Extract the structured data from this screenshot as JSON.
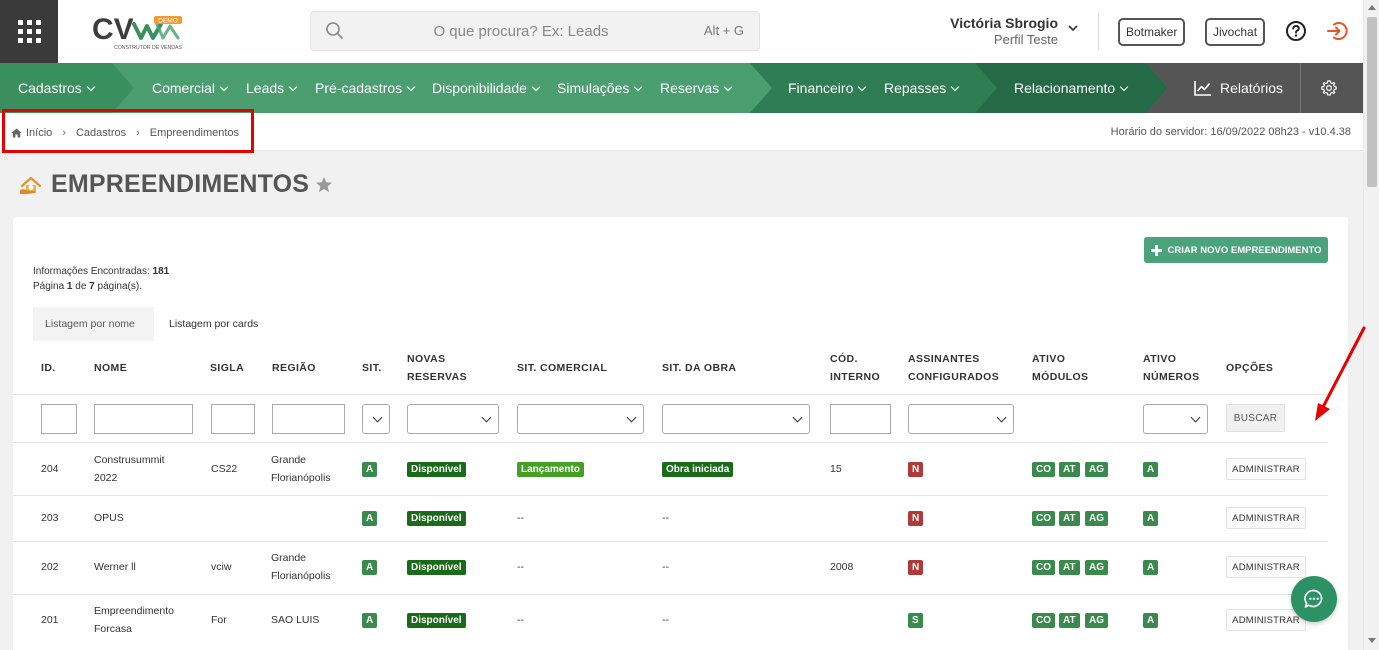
{
  "header": {
    "logo_text": "CV",
    "logo_badge": "DEMO",
    "logo_tagline": "CONSTRUTOR DE VENDAS",
    "search_placeholder": "O que procura? Ex: Leads",
    "search_shortcut": "Alt + G",
    "user_name": "Victória Sbrogio",
    "user_role": "Perfil Teste",
    "botmaker_label": "Botmaker",
    "jivochat_label": "Jivochat"
  },
  "nav": {
    "items": [
      {
        "label": "Cadastros"
      },
      {
        "label": "Comercial"
      },
      {
        "label": "Leads"
      },
      {
        "label": "Pré-cadastros"
      },
      {
        "label": "Disponibilidade"
      },
      {
        "label": "Simulações"
      },
      {
        "label": "Reservas"
      },
      {
        "label": "Financeiro"
      },
      {
        "label": "Repasses"
      },
      {
        "label": "Relacionamento"
      }
    ],
    "reports_label": "Relatórios",
    "colors": {
      "base": "#3a8f5f",
      "light": "#4ea877",
      "mid": "#2f7d53",
      "dark": "#256a46",
      "grey": "#555555"
    }
  },
  "breadcrumb": {
    "items": [
      "Início",
      "Cadastros",
      "Empreendimentos"
    ],
    "server_time": "Horário do servidor: 16/09/2022 08h23 - v10.4.38"
  },
  "page": {
    "title": "EMPREENDIMENTOS",
    "create_button": "CRIAR NOVO EMPREENDIMENTO",
    "info_found_label": "Informações Encontradas:",
    "info_found_count": "181",
    "page_word": "Página",
    "page_current": "1",
    "page_of": "de",
    "page_total": "7",
    "page_suffix": "página(s).",
    "tabs": [
      {
        "label": "Listagem por nome",
        "active": true
      },
      {
        "label": "Listagem por cards",
        "active": false
      }
    ]
  },
  "table": {
    "headers": {
      "id": "ID.",
      "nome": "NOME",
      "sigla": "SIGLA",
      "regiao": "REGIÃO",
      "sit": "SIT.",
      "novas_reservas": "NOVAS RESERVAS",
      "sit_comercial": "SIT. COMERCIAL",
      "sit_obra": "SIT. DA OBRA",
      "cod_interno": "CÓD. INTERNO",
      "assinantes": "ASSINANTES CONFIGURADOS",
      "ativo_modulos": "ATIVO MÓDULOS",
      "ativo_numeros": "ATIVO NÚMEROS",
      "opcoes": "OPÇÕES"
    },
    "search_button": "BUSCAR",
    "rows": [
      {
        "id": "204",
        "nome": "Construsummit 2022",
        "sigla": "CS22",
        "regiao": "Grande Florianópolis",
        "sit": "A",
        "novas_reservas": "Disponível",
        "sit_comercial": "Lançamento",
        "sit_obra": "Obra iniciada",
        "cod_interno": "15",
        "assinantes": "N",
        "modulos": [
          "CO",
          "AT",
          "AG"
        ],
        "numeros": "A",
        "action": "ADMINISTRAR"
      },
      {
        "id": "203",
        "nome": "OPUS",
        "sigla": "",
        "regiao": "",
        "sit": "A",
        "novas_reservas": "Disponível",
        "sit_comercial": "--",
        "sit_obra": "--",
        "cod_interno": "",
        "assinantes": "N",
        "modulos": [
          "CO",
          "AT",
          "AG"
        ],
        "numeros": "A",
        "action": "ADMINISTRAR"
      },
      {
        "id": "202",
        "nome": "Werner ll",
        "sigla": "vciw",
        "regiao": "Grande Florianópolis",
        "sit": "A",
        "novas_reservas": "Disponível",
        "sit_comercial": "--",
        "sit_obra": "--",
        "cod_interno": "2008",
        "assinantes": "N",
        "modulos": [
          "CO",
          "AT",
          "AG"
        ],
        "numeros": "A",
        "action": "ADMINISTRAR"
      },
      {
        "id": "201",
        "nome": "Empreendimento Forcasa",
        "sigla": "For",
        "regiao": "SAO LUIS",
        "sit": "A",
        "novas_reservas": "Disponível",
        "sit_comercial": "--",
        "sit_obra": "--",
        "cod_interno": "",
        "assinantes": "S",
        "modulos": [
          "CO",
          "AT",
          "AG"
        ],
        "numeros": "A",
        "action": "ADMINISTRAR"
      }
    ]
  },
  "icons": {
    "apps": "apps-grid-icon",
    "search": "search-icon",
    "help": "help-icon",
    "logout": "logout-icon",
    "reports": "line-chart-icon",
    "settings": "gear-icon",
    "home": "home-icon",
    "title": "building-icon",
    "favorite": "star-icon",
    "chat": "chat-icon"
  },
  "colors": {
    "accent": "#3a8f5f",
    "create_button": "#4aa37a",
    "badge_green": "#3a8a4e",
    "badge_dark_green": "#1a6a1a",
    "badge_light_green": "#45a025",
    "badge_red": "#b03a3a",
    "highlight": "#e60000",
    "logout": "#e8572b",
    "chat": "#2d9166"
  }
}
